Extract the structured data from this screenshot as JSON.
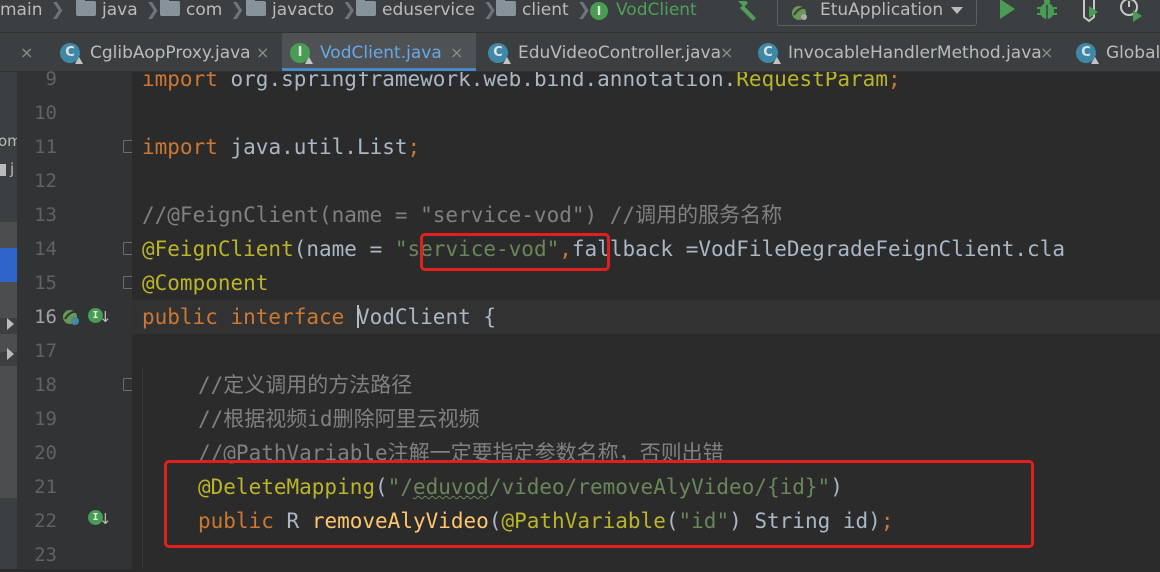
{
  "breadcrumb": [
    {
      "label": "main",
      "icon": "none"
    },
    {
      "label": "java",
      "icon": "folder-icon"
    },
    {
      "label": "com",
      "icon": "folder-icon"
    },
    {
      "label": "javacto",
      "icon": "folder-icon"
    },
    {
      "label": "eduservice",
      "icon": "folder-icon"
    },
    {
      "label": "client",
      "icon": "folder-icon"
    },
    {
      "label": "VodClient",
      "icon": "interface-icon"
    }
  ],
  "toolbar": {
    "run_config": "EtuApplication",
    "buttons": [
      "hammer-icon",
      "run-icon",
      "debug-icon",
      "coverage-icon",
      "profile-icon"
    ]
  },
  "tabs": [
    {
      "label": "CglibAopProxy.java",
      "close": "×",
      "icon": "class-icon",
      "icon_letter": "C",
      "active": false
    },
    {
      "label": "VodClient.java",
      "close": "×",
      "icon": "interface-icon",
      "icon_letter": "I",
      "active": true
    },
    {
      "label": "EduVideoController.java",
      "close": "×",
      "icon": "class-icon",
      "icon_letter": "C",
      "active": false
    },
    {
      "label": "InvocableHandlerMethod.java",
      "close": "×",
      "icon": "class-icon",
      "icon_letter": "C",
      "active": false
    },
    {
      "label": "Global",
      "close": "",
      "icon": "class-icon",
      "icon_letter": "C",
      "active": false
    }
  ],
  "left_strip": {
    "text1": "om",
    "text2": "j"
  },
  "line_numbers": [
    "9",
    "10",
    "11",
    "12",
    "13",
    "14",
    "15",
    "16",
    "17",
    "18",
    "19",
    "20",
    "21",
    "22",
    "23"
  ],
  "current_line": "16",
  "code": {
    "l9_kw": "import ",
    "l9_rest": "org.springframework.web.bind.annotation.",
    "l9_ann": "RequestParam",
    "l9_semi": ";",
    "l11_kw": "import ",
    "l11_rest": "java.util.List",
    "l11_semi": ";",
    "l13_cmt": "//@FeignClient(name = \"service-vod\") //调用的服务名称",
    "l14_ann": "@FeignClient",
    "l14_open": "(name = ",
    "l14_str": "\"service-vod\"",
    "l14_comma": ",",
    "l14_rest": "fallback =VodFileDegradeFeignClient.cla",
    "l15_ann": "@Component",
    "l16_kw": "public interface ",
    "l16_name": "VodClient",
    "l16_brace": " {",
    "l18_cmt": "//定义调用的方法路径",
    "l19_cmt": "//根据视频id删除阿里云视频",
    "l20_cmt": "//@PathVariable注解一定要指定参数名称，否则出错",
    "l21_ann": "@DeleteMapping",
    "l21_open": "(",
    "l21_str_a": "\"/",
    "l21_str_typo": "eduvod",
    "l21_str_b": "/video/removeAlyVideo/{id}\"",
    "l21_close": ")",
    "l22_kw": "public ",
    "l22_type": "R ",
    "l22_fn": "removeAlyVideo",
    "l22_open": "(",
    "l22_ann": "@PathVariable",
    "l22_p1": "(",
    "l22_str": "\"id\"",
    "l22_rest": ") String id)",
    "l22_semi": ";"
  },
  "colors": {
    "keyword": "#cc7832",
    "annotation": "#bbb529",
    "string": "#6a8759",
    "comment": "#808080",
    "method": "#ffc66d",
    "highlight_box": "#e0201f"
  }
}
